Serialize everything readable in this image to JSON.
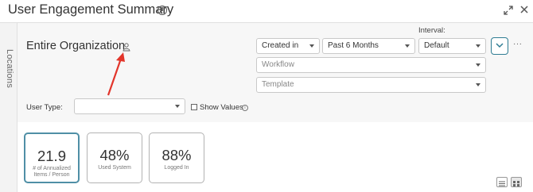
{
  "header": {
    "title": "User Engagement Summary",
    "icons": [
      "info-icon",
      "expand-icon",
      "close-icon"
    ]
  },
  "sidebar": {
    "rail_label": "Locations"
  },
  "scope": {
    "org_name": "Entire Organization",
    "icon": "person-icon",
    "annotation": "red-arrow"
  },
  "filters": {
    "date_field": "Created in",
    "date_range": "Past 6 Months",
    "interval_label": "Interval:",
    "interval_value": "Default",
    "workflow_placeholder": "Workflow",
    "template_placeholder": "Template",
    "user_type_label": "User Type:",
    "user_type_value": "",
    "show_values_label": "Show Values",
    "show_values_checked": false,
    "more_label": "···"
  },
  "cards": [
    {
      "value": "21.9",
      "caption": "# of Annualized Items / Person",
      "active": true
    },
    {
      "value": "48%",
      "caption": "Used System",
      "active": false
    },
    {
      "value": "88%",
      "caption": "Logged In",
      "active": false
    }
  ],
  "colors": {
    "accent": "#2f7c93",
    "annotation_red": "#e2352b"
  }
}
